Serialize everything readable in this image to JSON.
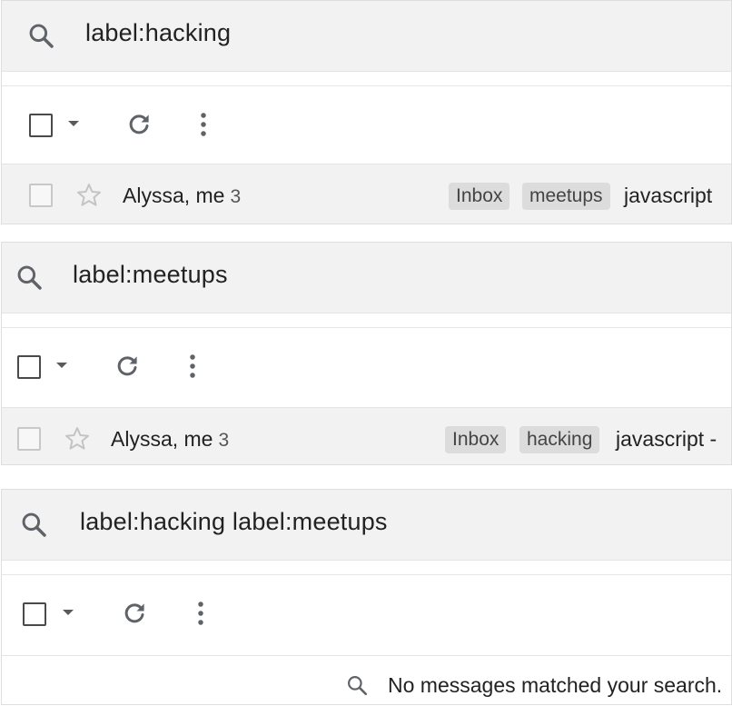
{
  "panels": [
    {
      "query": "label:hacking",
      "thread": {
        "sender": "Alyssa, me",
        "count": "3",
        "labels": [
          "Inbox",
          "meetups"
        ],
        "subject": "javascript"
      }
    },
    {
      "query": "label:meetups",
      "thread": {
        "sender": "Alyssa, me",
        "count": "3",
        "labels": [
          "Inbox",
          "hacking"
        ],
        "subject": "javascript -"
      }
    },
    {
      "query": "label:hacking label:meetups",
      "empty_message": "No messages matched your search."
    }
  ],
  "icons": [
    "search-icon",
    "select-checkbox",
    "select-dropdown-icon",
    "refresh-icon",
    "more-options-icon",
    "star-icon"
  ],
  "colors": {
    "search_bg": "#f2f2f2",
    "row_bg": "#f2f2f2",
    "chip_bg": "#dcdcdc",
    "icon": "#5f6368"
  }
}
